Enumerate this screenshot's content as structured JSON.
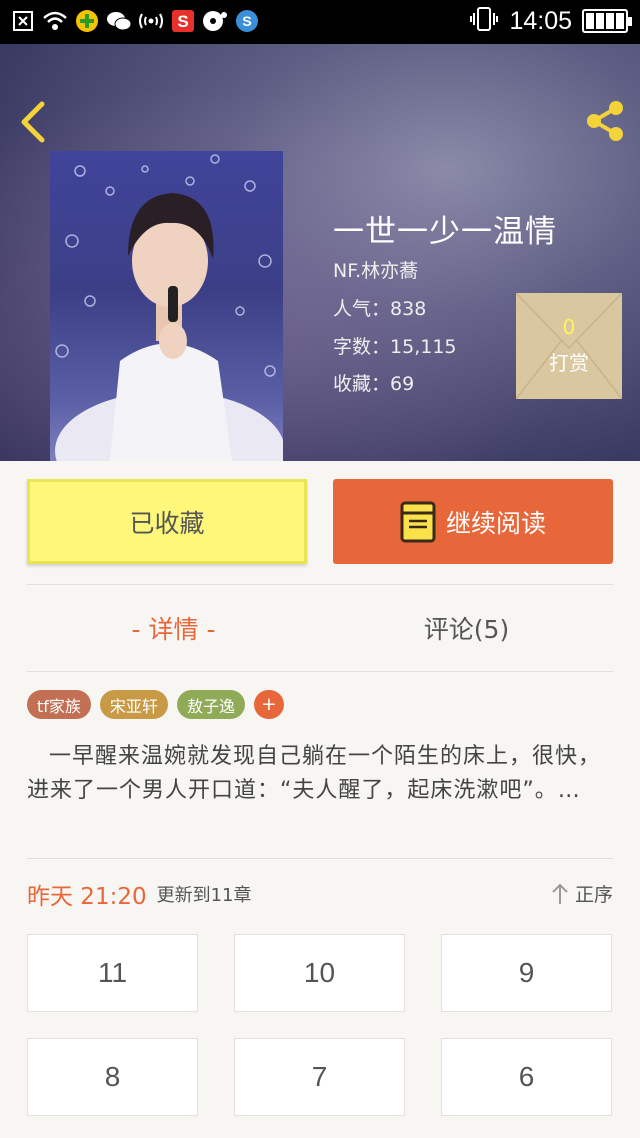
{
  "status_bar": {
    "time": "14:05",
    "left_icons": [
      "close-box-icon",
      "wifi-icon",
      "app-icon",
      "wechat-icon",
      "signal-icon",
      "sogou-icon",
      "music-icon",
      "browser-icon"
    ],
    "right_icons": [
      "vibrate-icon",
      "battery-icon"
    ]
  },
  "book": {
    "title": "一世一少一温情",
    "author": "NF.林亦蕎",
    "stats": [
      {
        "label": "人气：",
        "value": "838"
      },
      {
        "label": "字数：",
        "value": "15,115"
      },
      {
        "label": "收藏：",
        "value": "69"
      }
    ]
  },
  "reward": {
    "count": "0",
    "label": "打赏"
  },
  "actions": {
    "collected": "已收藏",
    "continue_read": "继续阅读"
  },
  "tabs": {
    "details": "- 详情 -",
    "comments": "评论(5)"
  },
  "tags": [
    {
      "label": "tf家族",
      "color": "#c26f53"
    },
    {
      "label": "宋亚轩",
      "color": "#c99a45"
    },
    {
      "label": "敖子逸",
      "color": "#8fab58"
    }
  ],
  "tag_add": "+",
  "description": "一早醒来温婉就发现自己躺在一个陌生的床上，很快，进来了一个男人开口道：“夫人醒了，起床洗漱吧”。…",
  "update": {
    "time": "昨天 21:20",
    "text": "更新到11章",
    "sort_label": "正序"
  },
  "chapters": [
    "11",
    "10",
    "9",
    "8",
    "7",
    "6"
  ],
  "colors": {
    "accent": "#e8673a",
    "collected_bg": "#fdf77a",
    "reward_bg": "#d9c7a0"
  }
}
